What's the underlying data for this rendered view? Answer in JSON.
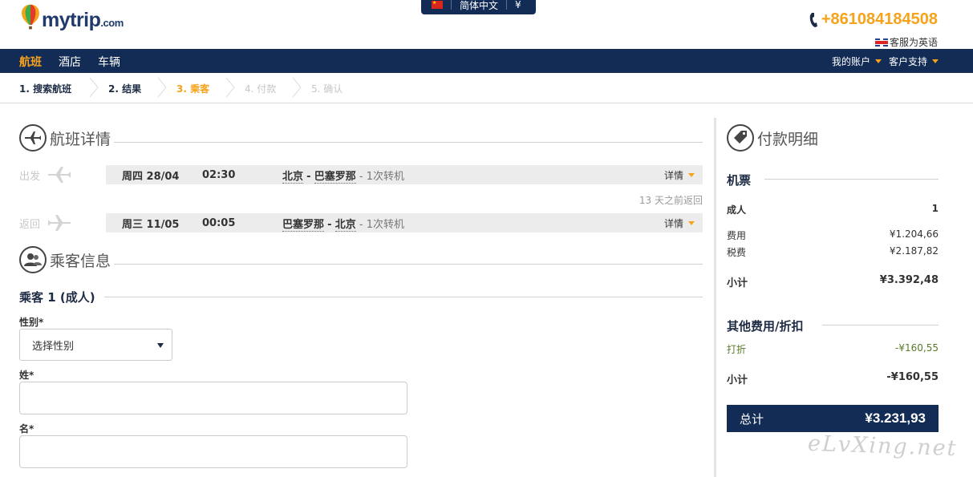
{
  "header": {
    "brand": "mytrip",
    "brand_suffix": ".com",
    "language": "简体中文",
    "currency": "¥",
    "phone": "+861084184508",
    "support_language": "客服为英语"
  },
  "nav": {
    "items": [
      {
        "label": "航班",
        "active": true
      },
      {
        "label": "酒店",
        "active": false
      },
      {
        "label": "车辆",
        "active": false
      }
    ],
    "account": "我的账户",
    "support": "客户支持"
  },
  "steps": [
    {
      "label": "1. 搜索航班",
      "state": "done"
    },
    {
      "label": "2. 结果",
      "state": "done"
    },
    {
      "label": "3. 乘客",
      "state": "current"
    },
    {
      "label": "4. 付款",
      "state": "future"
    },
    {
      "label": "5. 确认",
      "state": "future"
    }
  ],
  "flight_details": {
    "title": "航班详情",
    "outbound": {
      "direction": "出发",
      "date": "周四 28/04",
      "time": "02:30",
      "from": "北京",
      "to": "巴塞罗那",
      "stops": "1次转机",
      "details_label": "详情"
    },
    "return_note": "13 天之前返回",
    "inbound": {
      "direction": "返回",
      "date": "周三 11/05",
      "time": "00:05",
      "from": "巴塞罗那",
      "to": "北京",
      "stops": "1次转机",
      "details_label": "详情"
    }
  },
  "passenger_info": {
    "title": "乘客信息",
    "passenger_heading": "乘客 1 (成人)",
    "gender_label": "性别*",
    "gender_placeholder": "选择性别",
    "last_name_label": "姓*",
    "last_name_value": "",
    "first_name_label": "名*",
    "first_name_value": ""
  },
  "payment": {
    "title": "付款明细",
    "ticket_heading": "机票",
    "adult_label": "成人",
    "adult_count": "1",
    "fee_label": "费用",
    "fee_value": "¥1.204,66",
    "tax_label": "税费",
    "tax_value": "¥2.187,82",
    "subtotal_label": "小计",
    "subtotal_value": "¥3.392,48",
    "other_heading": "其他费用/折扣",
    "discount_label": "打折",
    "discount_value": "-¥160,55",
    "subtotal2_label": "小计",
    "subtotal2_value": "-¥160,55",
    "total_label": "总计",
    "total_value": "¥3.231,93"
  },
  "watermark": "eLvXing.net",
  "colors": {
    "navy": "#122c55",
    "accent": "#f7a21b",
    "discount_green": "#5a7a2a"
  }
}
